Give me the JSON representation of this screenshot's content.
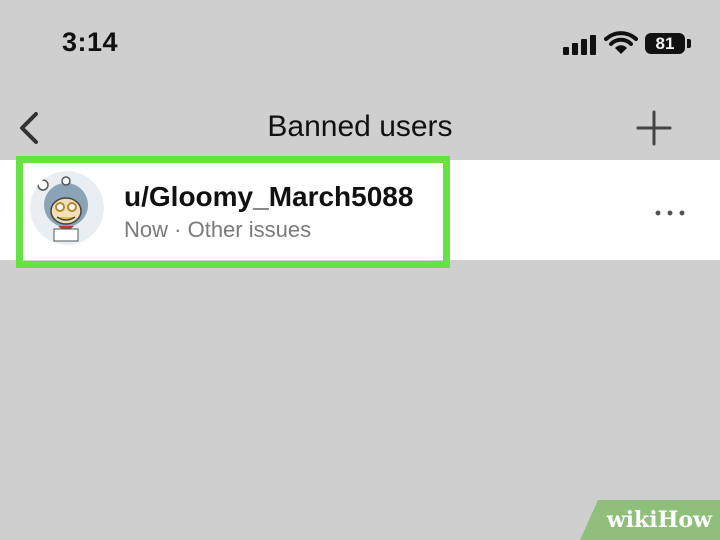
{
  "status_bar": {
    "time": "3:14",
    "battery_level": "81",
    "icons": [
      "cellular-signal-icon",
      "wifi-icon",
      "battery-icon"
    ]
  },
  "header": {
    "title": "Banned users",
    "back_icon": "chevron-left-icon",
    "add_icon": "plus-icon"
  },
  "banned_users": [
    {
      "username": "u/Gloomy_March5088",
      "time": "Now",
      "separator": "·",
      "reason": "Other issues",
      "avatar": "snoo-avatar",
      "menu_icon": "more-horizontal-icon"
    }
  ],
  "colors": {
    "background": "#cfcfcf",
    "row_background": "#ffffff",
    "highlight": "#66e343",
    "watermark": "#8fbf7a"
  },
  "watermark": {
    "prefix": "wiki",
    "suffix": "How"
  }
}
